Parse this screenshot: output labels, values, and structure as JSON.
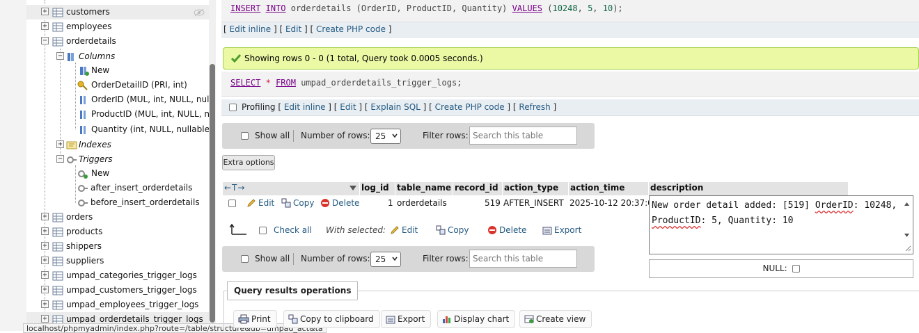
{
  "nav": {
    "tables_top": [
      {
        "name": "customers"
      },
      {
        "name": "employees"
      },
      {
        "name": "orderdetails"
      }
    ],
    "columns_group": "Columns",
    "new_label": "New",
    "columns": [
      "OrderDetailID (PRI, int)",
      "OrderID (MUL, int, NULL, nullable)",
      "ProductID (MUL, int, NULL, nullable)",
      "Quantity (int, NULL, nullable)"
    ],
    "indexes_group": "Indexes",
    "triggers_group": "Triggers",
    "triggers": [
      "after_insert_orderdetails",
      "before_insert_orderdetails"
    ],
    "tables_bottom": [
      "orders",
      "products",
      "shippers",
      "suppliers",
      "umpad_categories_trigger_logs",
      "umpad_customers_trigger_logs",
      "umpad_employees_trigger_logs",
      "umpad_orderdetails_trigger_logs"
    ],
    "status_url": "localhost/phpmyadmin/index.php?route=/table/structure&db=umpad_act&ta"
  },
  "query1": {
    "kw_insert": "INSERT",
    "kw_into": "INTO",
    "table": "orderdetails",
    "cols": "(OrderID, ProductID, Quantity)",
    "kw_values": "VALUES",
    "open": "(",
    "v1": "10248",
    "v2": "5",
    "v3": "10",
    "close": ");"
  },
  "links1": {
    "edit_inline": "Edit inline",
    "edit": "Edit",
    "create_php": "Create PHP code"
  },
  "success_msg": "Showing rows 0 - 0 (1 total, Query took 0.0005 seconds.)",
  "query2": {
    "kw_select": "SELECT",
    "star": "*",
    "kw_from": "FROM",
    "table": "umpad_orderdetails_trigger_logs;"
  },
  "links2": {
    "profiling": "Profiling",
    "edit_inline": "Edit inline",
    "edit": "Edit",
    "explain": "Explain SQL",
    "create_php": "Create PHP code",
    "refresh": "Refresh"
  },
  "toolbar": {
    "show_all": "Show all",
    "num_rows_label": "Number of rows:",
    "num_rows_value": "25",
    "filter_label": "Filter rows:",
    "filter_placeholder": "Search this table"
  },
  "extra_options": "Extra options",
  "table": {
    "columns": [
      "log_id",
      "table_name",
      "record_id",
      "action_type",
      "action_time",
      "description"
    ],
    "row": {
      "log_id": "1",
      "table_name": "orderdetails",
      "record_id": "519",
      "action_type": "AFTER_INSERT",
      "action_time": "2025-10-12 20:37:00",
      "desc_a": "New order detail added: [519] ",
      "desc_b": "OrderID",
      "desc_c": ": 10248,",
      "desc_d": "ProductID",
      "desc_e": ": 5, Quantity: 10"
    },
    "row_actions": {
      "edit": "Edit",
      "copy": "Copy",
      "delete": "Delete"
    },
    "null_label": "NULL:"
  },
  "bulk": {
    "check_all": "Check all",
    "with_selected": "With selected:",
    "edit": "Edit",
    "copy": "Copy",
    "delete": "Delete",
    "export": "Export"
  },
  "qro": {
    "title": "Query results operations",
    "print": "Print",
    "copy_clipboard": "Copy to clipboard",
    "export": "Export",
    "display_chart": "Display chart",
    "create_view": "Create view"
  },
  "colors": {
    "link": "#235a81",
    "success_bg": "#ebf8a4",
    "success_border": "#a2d246",
    "keyword": "#770088"
  }
}
